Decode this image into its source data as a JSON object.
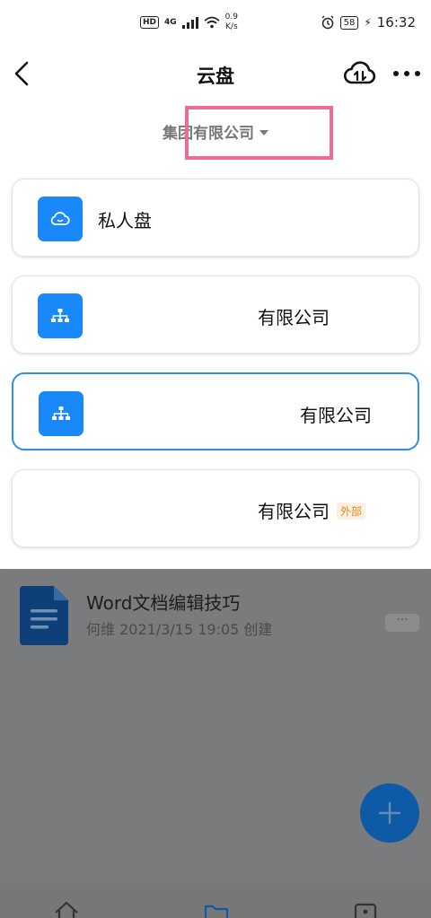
{
  "status_bar": {
    "hd": "HD",
    "network": "4G",
    "speed_value": "0.9",
    "speed_unit": "K/s",
    "battery": "58",
    "time": "16:32"
  },
  "nav": {
    "title": "云盘",
    "icons": {
      "back": "back-arrow-icon",
      "cloud": "cloud-transfer-icon",
      "more": "more-icon"
    }
  },
  "org_selector": {
    "label": "集团有限公司"
  },
  "spaces": [
    {
      "label": "私人盘",
      "icon": "cloud-face-icon"
    },
    {
      "label": "有限公司",
      "icon": "org-chart-icon"
    },
    {
      "label": "有限公司",
      "icon": "org-chart-icon",
      "selected": true
    },
    {
      "label": "有限公司",
      "badge": "外部"
    }
  ],
  "file_list": {
    "items": [
      {
        "title": "Word文档编辑技巧",
        "meta": "何维 2021/3/15 19:05 创建",
        "more": "···"
      }
    ]
  },
  "colors": {
    "accent": "#1989fa",
    "highlight": "#ee6b96",
    "badge_text": "#e08b23"
  }
}
